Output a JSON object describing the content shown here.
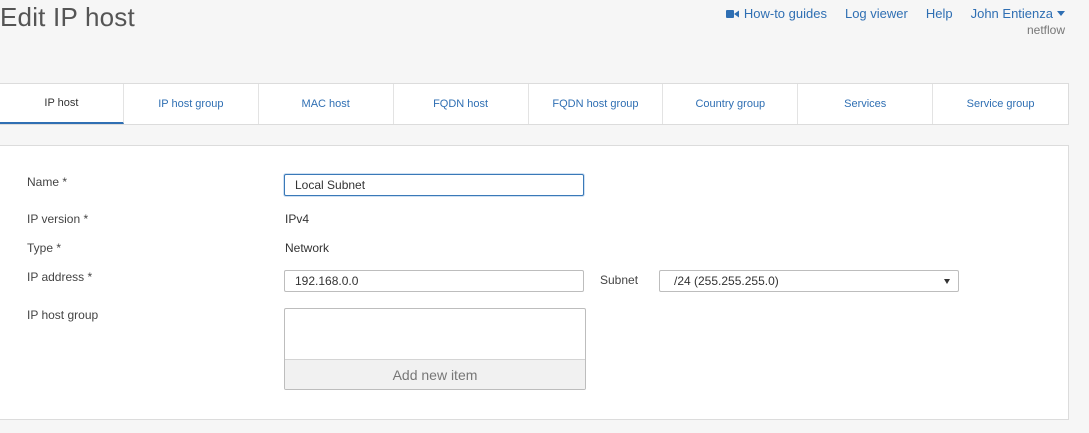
{
  "header": {
    "title": "Edit IP host",
    "nav": {
      "how_to": "How-to guides",
      "log_viewer": "Log viewer",
      "help": "Help",
      "user": "John Entienza"
    },
    "sub_user": "netflow"
  },
  "tabs": [
    {
      "label": "IP host",
      "active": true
    },
    {
      "label": "IP host group"
    },
    {
      "label": "MAC host"
    },
    {
      "label": "FQDN host"
    },
    {
      "label": "FQDN host group"
    },
    {
      "label": "Country group"
    },
    {
      "label": "Services"
    },
    {
      "label": "Service group"
    }
  ],
  "form": {
    "name_label": "Name *",
    "name_value": "Local Subnet",
    "ip_version_label": "IP version *",
    "ip_version_value": "IPv4",
    "type_label": "Type *",
    "type_value": "Network",
    "ip_address_label": "IP address *",
    "ip_address_value": "192.168.0.0",
    "subnet_label": "Subnet",
    "subnet_value": "/24 (255.255.255.0)",
    "ip_host_group_label": "IP host group",
    "add_item_label": "Add new item"
  },
  "colors": {
    "accent": "#2f6fb3",
    "background": "#f6f6f6"
  },
  "icons": {
    "how_to": "video-camera-icon",
    "user_menu": "caret-down-icon"
  }
}
